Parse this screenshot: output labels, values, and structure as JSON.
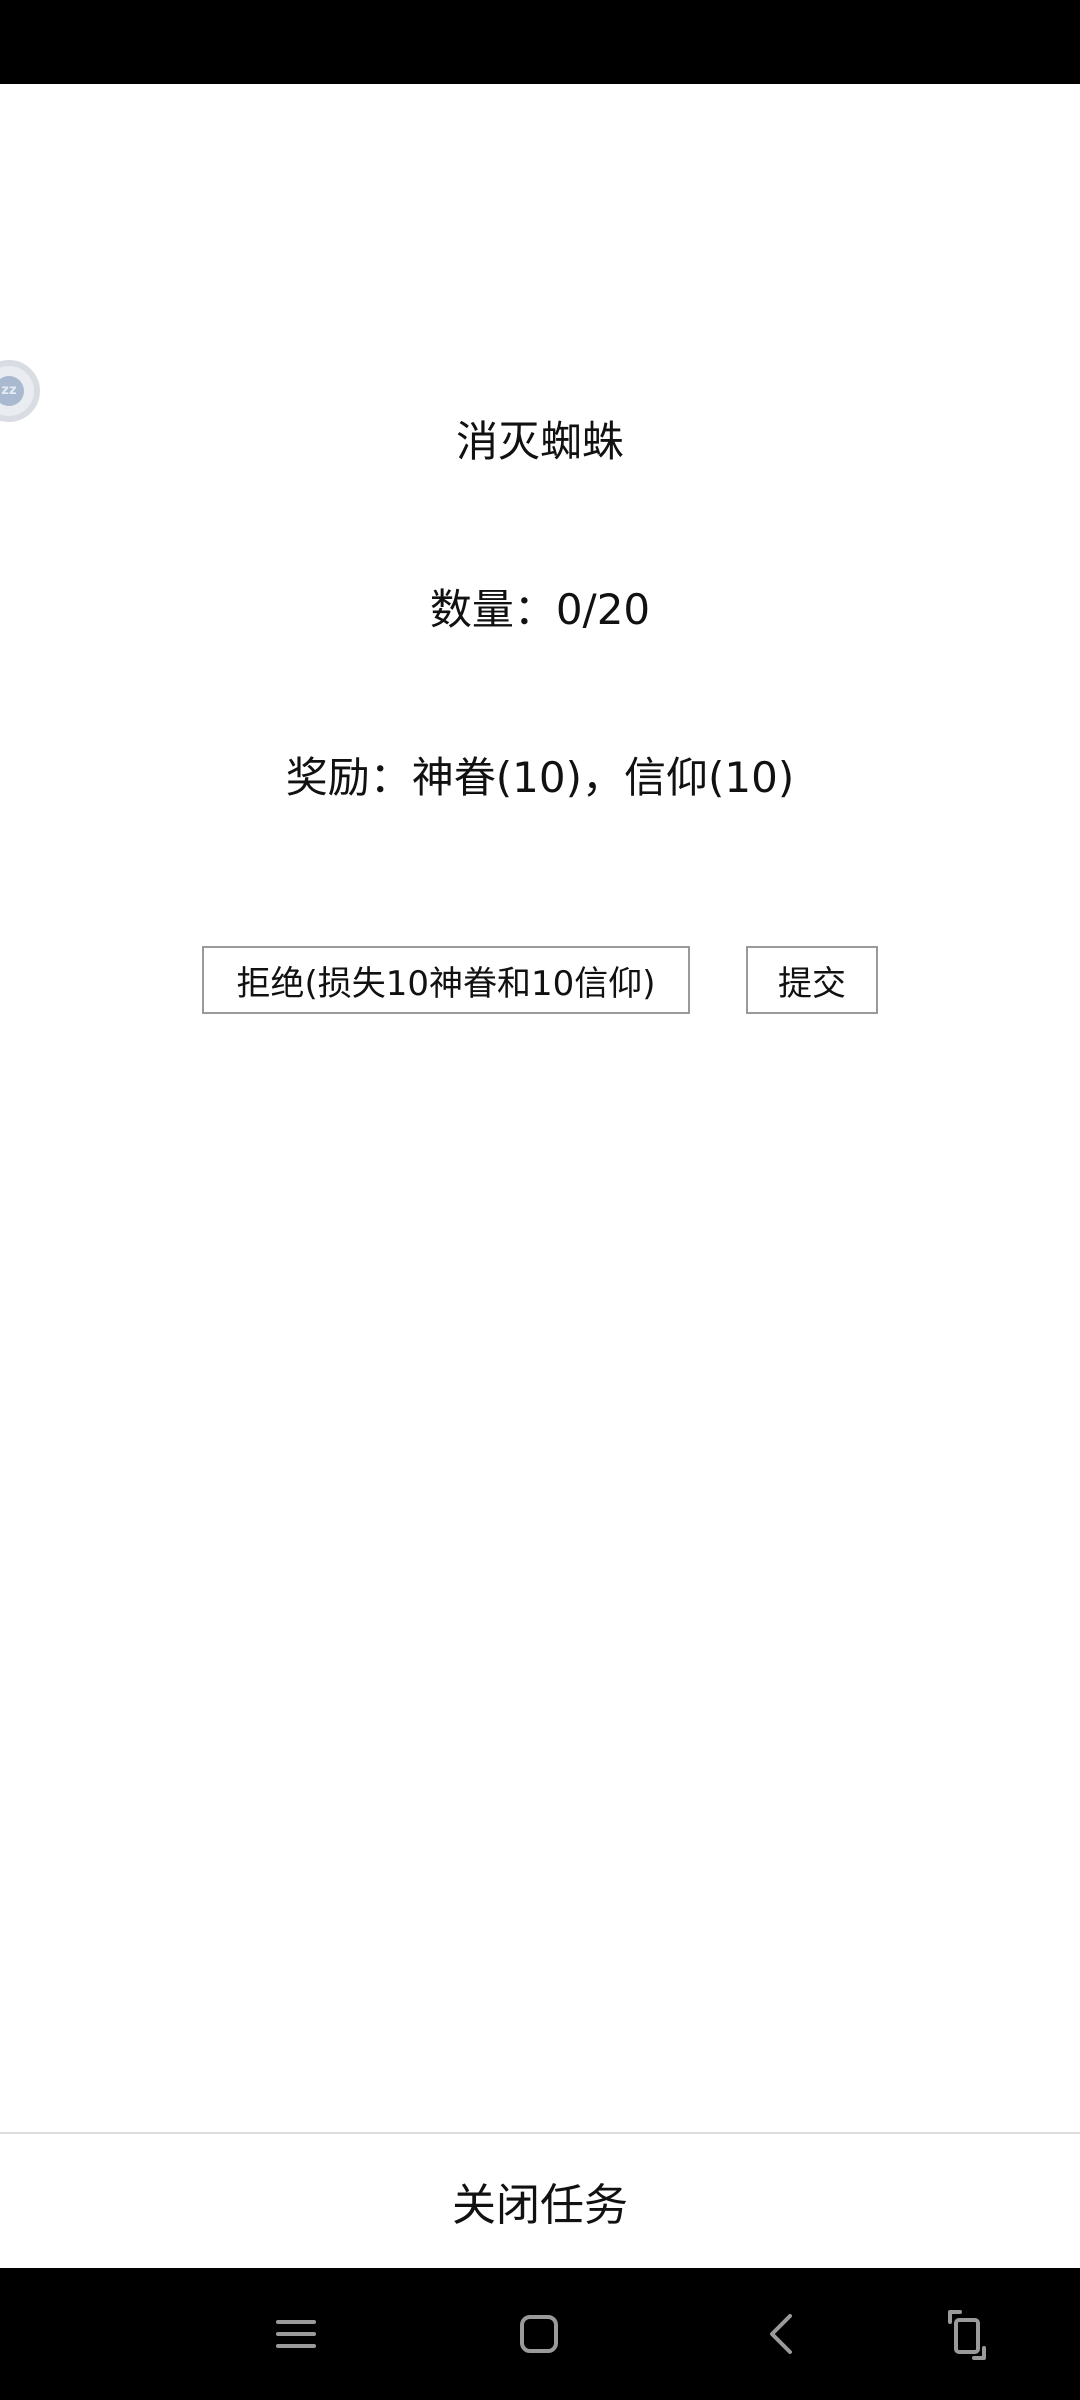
{
  "floating_badge": {
    "text": "zz",
    "icon": "floating-ball-icon"
  },
  "quest": {
    "title": "消灭蜘蛛",
    "count": "数量：0/20",
    "reward": "奖励：神眷(10)，信仰(10)"
  },
  "actions": {
    "reject_label": "拒绝(损失10神眷和10信仰)",
    "submit_label": "提交"
  },
  "footer": {
    "close_label": "关闭任务"
  },
  "nav": {
    "icons": [
      "menu-icon",
      "home-icon",
      "back-icon",
      "rotate-icon"
    ]
  },
  "colors": {
    "background": "#ffffff",
    "bars": "#000000",
    "button_border": "#9a9a9a",
    "text": "#111111"
  }
}
